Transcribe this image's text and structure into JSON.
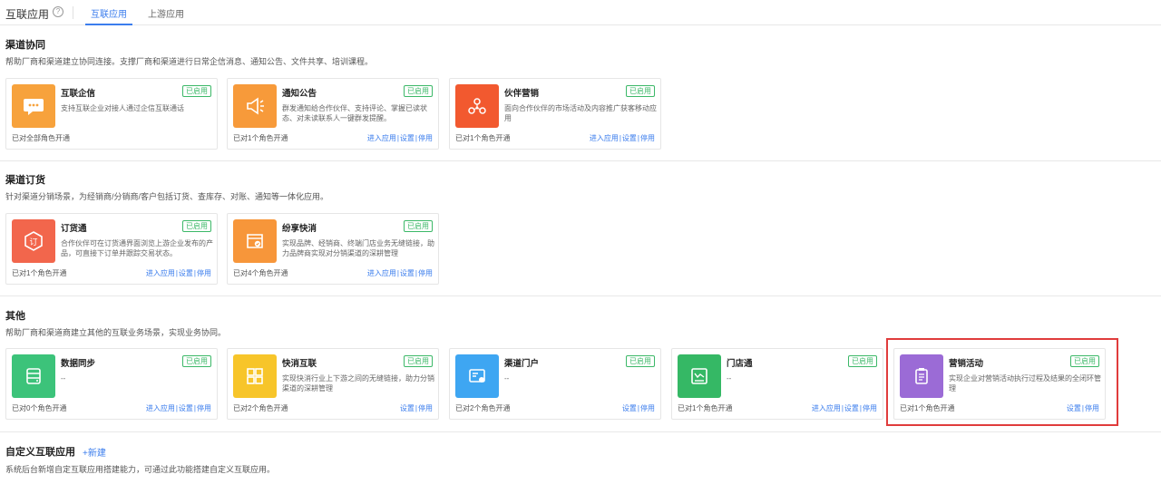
{
  "header": {
    "title": "互联应用",
    "help_icon": "?",
    "tabs": [
      {
        "label": "互联应用",
        "active": true
      },
      {
        "label": "上游应用",
        "active": false
      }
    ]
  },
  "colors": {
    "accent": "#3b7ded",
    "enabled": "#3cb868",
    "highlight": "#e03c3c"
  },
  "sections": [
    {
      "title": "渠道协同",
      "desc": "帮助厂商和渠道建立协同连接。支撑厂商和渠道进行日常企信消息、通知公告、文件共享、培训课程。",
      "cards": [
        {
          "name": "互联企信",
          "badge": "已启用",
          "desc": "支持互联企业对接人通过企信互联通话",
          "status": "已对全部角色开通",
          "actions": [],
          "icon": "chat-bubble-icon",
          "color": "#f7a23c"
        },
        {
          "name": "通知公告",
          "badge": "已启用",
          "desc": "群发通知给合作伙伴、支持评论、掌握已读状态、对未读联系人一键群发提醒。",
          "status": "已对1个角色开通",
          "actions": [
            "进入应用",
            "设置",
            "停用"
          ],
          "icon": "megaphone-icon",
          "color": "#f79a3a"
        },
        {
          "name": "伙伴营销",
          "badge": "已启用",
          "desc": "面向合作伙伴的市场活动及内容推广获客移动应用",
          "status": "已对1个角色开通",
          "actions": [
            "进入应用",
            "设置",
            "停用"
          ],
          "icon": "network-icon",
          "color": "#f2592f"
        }
      ]
    },
    {
      "title": "渠道订货",
      "desc": "针对渠道分销场景，为经销商/分销商/客户包括订货、查库存、对账、通知等一体化应用。",
      "cards": [
        {
          "name": "订货通",
          "badge": "已启用",
          "desc": "合作伙伴可在订货通界面浏览上游企业发布的产品，可直接下订单并跟踪交易状态。",
          "status": "已对1个角色开通",
          "actions": [
            "进入应用",
            "设置",
            "停用"
          ],
          "icon": "order-icon",
          "color": "#f2664c"
        },
        {
          "name": "纷享快消",
          "badge": "已启用",
          "desc": "实现品牌、经销商、终端门店业务无缝链接，助力品牌商实现对分销渠道的深耕管理",
          "status": "已对4个角色开通",
          "actions": [
            "进入应用",
            "设置",
            "停用"
          ],
          "icon": "store-icon",
          "color": "#f7963a"
        }
      ]
    },
    {
      "title": "其他",
      "desc": "帮助厂商和渠道商建立其他的互联业务场景，实现业务协同。",
      "cards": [
        {
          "name": "数据同步",
          "badge": "已启用",
          "desc": "--",
          "status": "已对0个角色开通",
          "actions": [
            "进入应用",
            "设置",
            "停用"
          ],
          "icon": "database-icon",
          "color": "#3cc37a"
        },
        {
          "name": "快消互联",
          "badge": "已启用",
          "desc": "实现快消行业上下游之间的无缝链接，助力分销渠道的深耕管理",
          "status": "已对2个角色开通",
          "actions": [
            "设置",
            "停用"
          ],
          "icon": "grid-icon",
          "color": "#f7c52a"
        },
        {
          "name": "渠道门户",
          "badge": "已启用",
          "desc": "--",
          "status": "已对2个角色开通",
          "actions": [
            "设置",
            "停用"
          ],
          "icon": "portal-icon",
          "color": "#3ea6f2"
        },
        {
          "name": "门店通",
          "badge": "已启用",
          "desc": "--",
          "status": "已对1个角色开通",
          "actions": [
            "进入应用",
            "设置",
            "停用"
          ],
          "icon": "shop-icon",
          "color": "#35b865"
        },
        {
          "name": "营销活动",
          "badge": "已启用",
          "desc": "实现企业对营销活动执行过程及结果的全闭环管理",
          "status": "已对1个角色开通",
          "actions": [
            "设置",
            "停用"
          ],
          "icon": "clipboard-icon",
          "color": "#9b6bd6"
        }
      ]
    }
  ],
  "custom": {
    "title": "自定义互联应用",
    "new_label": "+新建",
    "desc": "系统后台新增自定互联应用搭建能力，可通过此功能搭建自定义互联应用。"
  }
}
